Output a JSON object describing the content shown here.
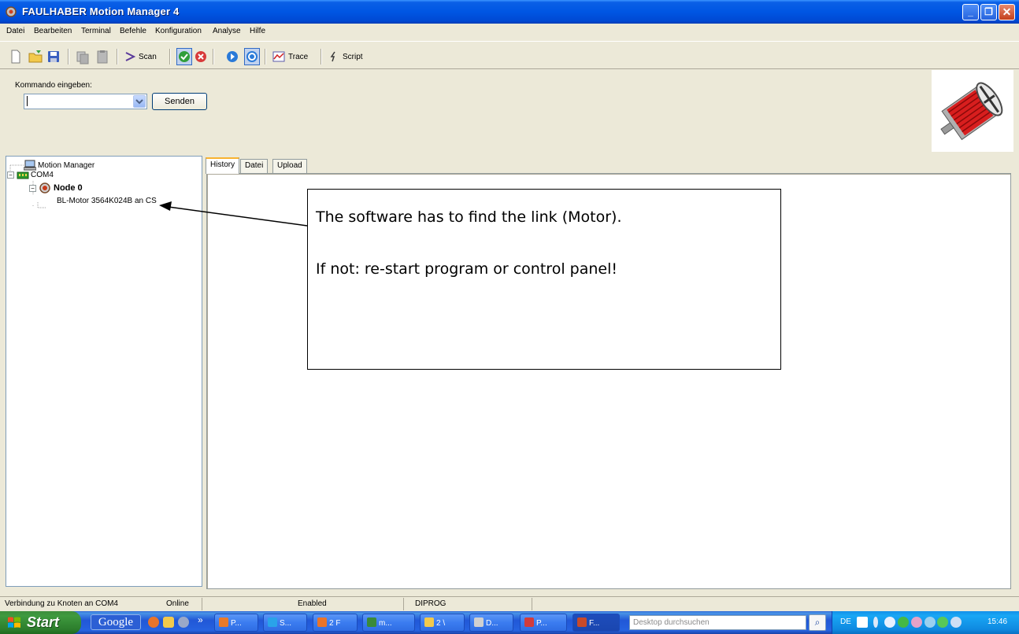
{
  "window": {
    "title": "FAULHABER Motion Manager 4",
    "buttons": {
      "minimize": "_",
      "maximize": "❐",
      "close": "✕"
    }
  },
  "menu": {
    "items": [
      "Datei",
      "Bearbeiten",
      "Terminal",
      "Befehle",
      "Konfiguration",
      "Analyse",
      "Hilfe"
    ]
  },
  "toolbar": {
    "scan_label": "Scan",
    "trace_label": "Trace",
    "script_label": "Script",
    "icons": [
      "new-document-icon",
      "open-folder-icon",
      "save-icon",
      "copy-icon",
      "paste-icon",
      "scan-icon",
      "connect-ok-icon",
      "disconnect-icon",
      "play-icon",
      "stop-icon",
      "trace-icon",
      "script-icon"
    ]
  },
  "command": {
    "label": "Kommando eingeben:",
    "value": "",
    "send_label": "Senden"
  },
  "tree": {
    "root": "Motion Manager",
    "port": "COM4",
    "node": "Node 0",
    "device": "BL-Motor 3564K024B an CS"
  },
  "tabs": {
    "history": "History",
    "datei": "Datei",
    "upload": "Upload",
    "active": "History"
  },
  "annotation": {
    "line1": "The software has to find the link (Motor).",
    "line2": "If not: re-start program or control panel!"
  },
  "status": {
    "connection": "Verbindung zu Knoten  an COM4",
    "online": "Online",
    "enabled": "Enabled",
    "mode": "DIPROG"
  },
  "taskbar": {
    "start": "Start",
    "google": "Google",
    "overflow": "»",
    "tasks": [
      {
        "label": "P...",
        "color": "#e97a2a"
      },
      {
        "label": "S...",
        "color": "#2aa3e9"
      },
      {
        "label": "2 F",
        "color": "#e9742a"
      },
      {
        "label": "m...",
        "color": "#3a8a3a"
      },
      {
        "label": "2 \\",
        "color": "#f2c94c"
      },
      {
        "label": "D...",
        "color": "#d0d0d0"
      },
      {
        "label": "P...",
        "color": "#d23c3c"
      },
      {
        "label": "F...",
        "color": "#c84a2a"
      }
    ],
    "search_placeholder": "Desktop durchsuchen",
    "lang": "DE",
    "clock": "15:46"
  },
  "colors": {
    "title_blue": "#0054e3",
    "xp_face": "#ece9d8",
    "start_green": "#3f9a3f"
  }
}
